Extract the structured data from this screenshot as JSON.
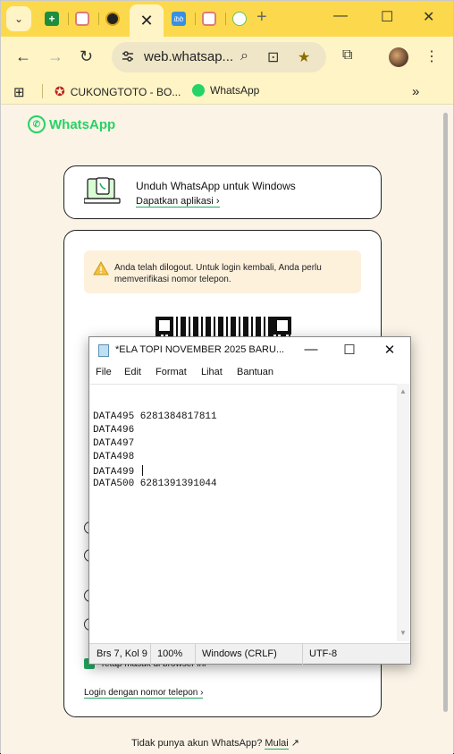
{
  "browser": {
    "active_tab_close": "✕",
    "new_tab": "+",
    "url": "web.whatsap...",
    "bookmarks": [
      "CUKONGTOTO - BO...",
      "WhatsApp"
    ],
    "more_bookmarks": "»",
    "accent_color": "#fcd94c"
  },
  "whatsapp": {
    "logo_text": "WhatsApp",
    "download_card": {
      "title": "Unduh WhatsApp untuk Windows",
      "link": "Dapatkan aplikasi"
    },
    "warning": "Anda telah dilogout. Untuk login kembali, Anda perlu memverifikasi nomor telepon.",
    "keep_signed_in": "Tetap masuk di browser ini",
    "login_phone": "Login dengan nomor telepon",
    "footer_question": "Tidak punya akun WhatsApp?",
    "footer_link": "Mulai"
  },
  "notepad": {
    "title": "*ELA TOPI NOVEMBER 2025 BARU...",
    "menu": [
      "File",
      "Edit",
      "Format",
      "Lihat",
      "Bantuan"
    ],
    "lines": [
      "DATA495 6281384817811",
      "DATA496",
      "DATA497",
      "DATA498",
      "DATA499 ",
      "DATA500 6281391391044"
    ],
    "status": {
      "position": "Brs 7, Kol 9",
      "zoom": "100%",
      "line_ending": "Windows (CRLF)",
      "encoding": "UTF-8"
    }
  }
}
